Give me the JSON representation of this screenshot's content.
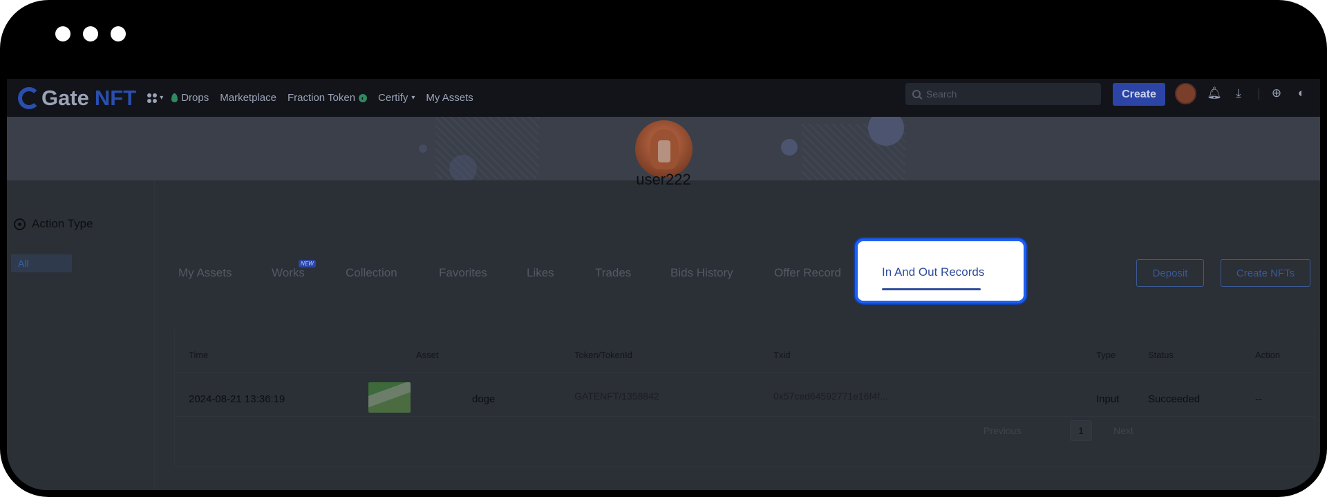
{
  "nav": {
    "logo_gate": "Gate",
    "logo_nft": "NFT",
    "links": [
      "Drops",
      "Marketplace",
      "Fraction Token",
      "Certify",
      "My Assets"
    ],
    "search_placeholder": "Search",
    "create_label": "Create"
  },
  "profile": {
    "username": "user222"
  },
  "sidebar": {
    "title": "Action Type",
    "filter_all": "All"
  },
  "tabs": {
    "items": [
      "My Assets",
      "Works",
      "Collection",
      "Favorites",
      "Likes",
      "Trades",
      "Bids History",
      "Offer Record"
    ],
    "new_badge": "NEW",
    "active": "In And Out Records"
  },
  "buttons": {
    "deposit": "Deposit",
    "create_nfts": "Create NFTs"
  },
  "table": {
    "columns": [
      "Time",
      "Asset",
      "Token/TokenId",
      "Txid",
      "Type",
      "Status",
      "Action"
    ],
    "rows": [
      {
        "time": "2024-08-21 13:36:19",
        "asset": "doge",
        "token": "GATENFT/1358842",
        "txid": "0x57ced64592771e16f4f...",
        "type": "Input",
        "status": "Succeeded",
        "action": "--"
      }
    ]
  },
  "pagination": {
    "previous": "Previous",
    "current": "1",
    "next": "Next"
  },
  "colors": {
    "accent": "#1e5ff3",
    "brand": "#2a4fae"
  }
}
